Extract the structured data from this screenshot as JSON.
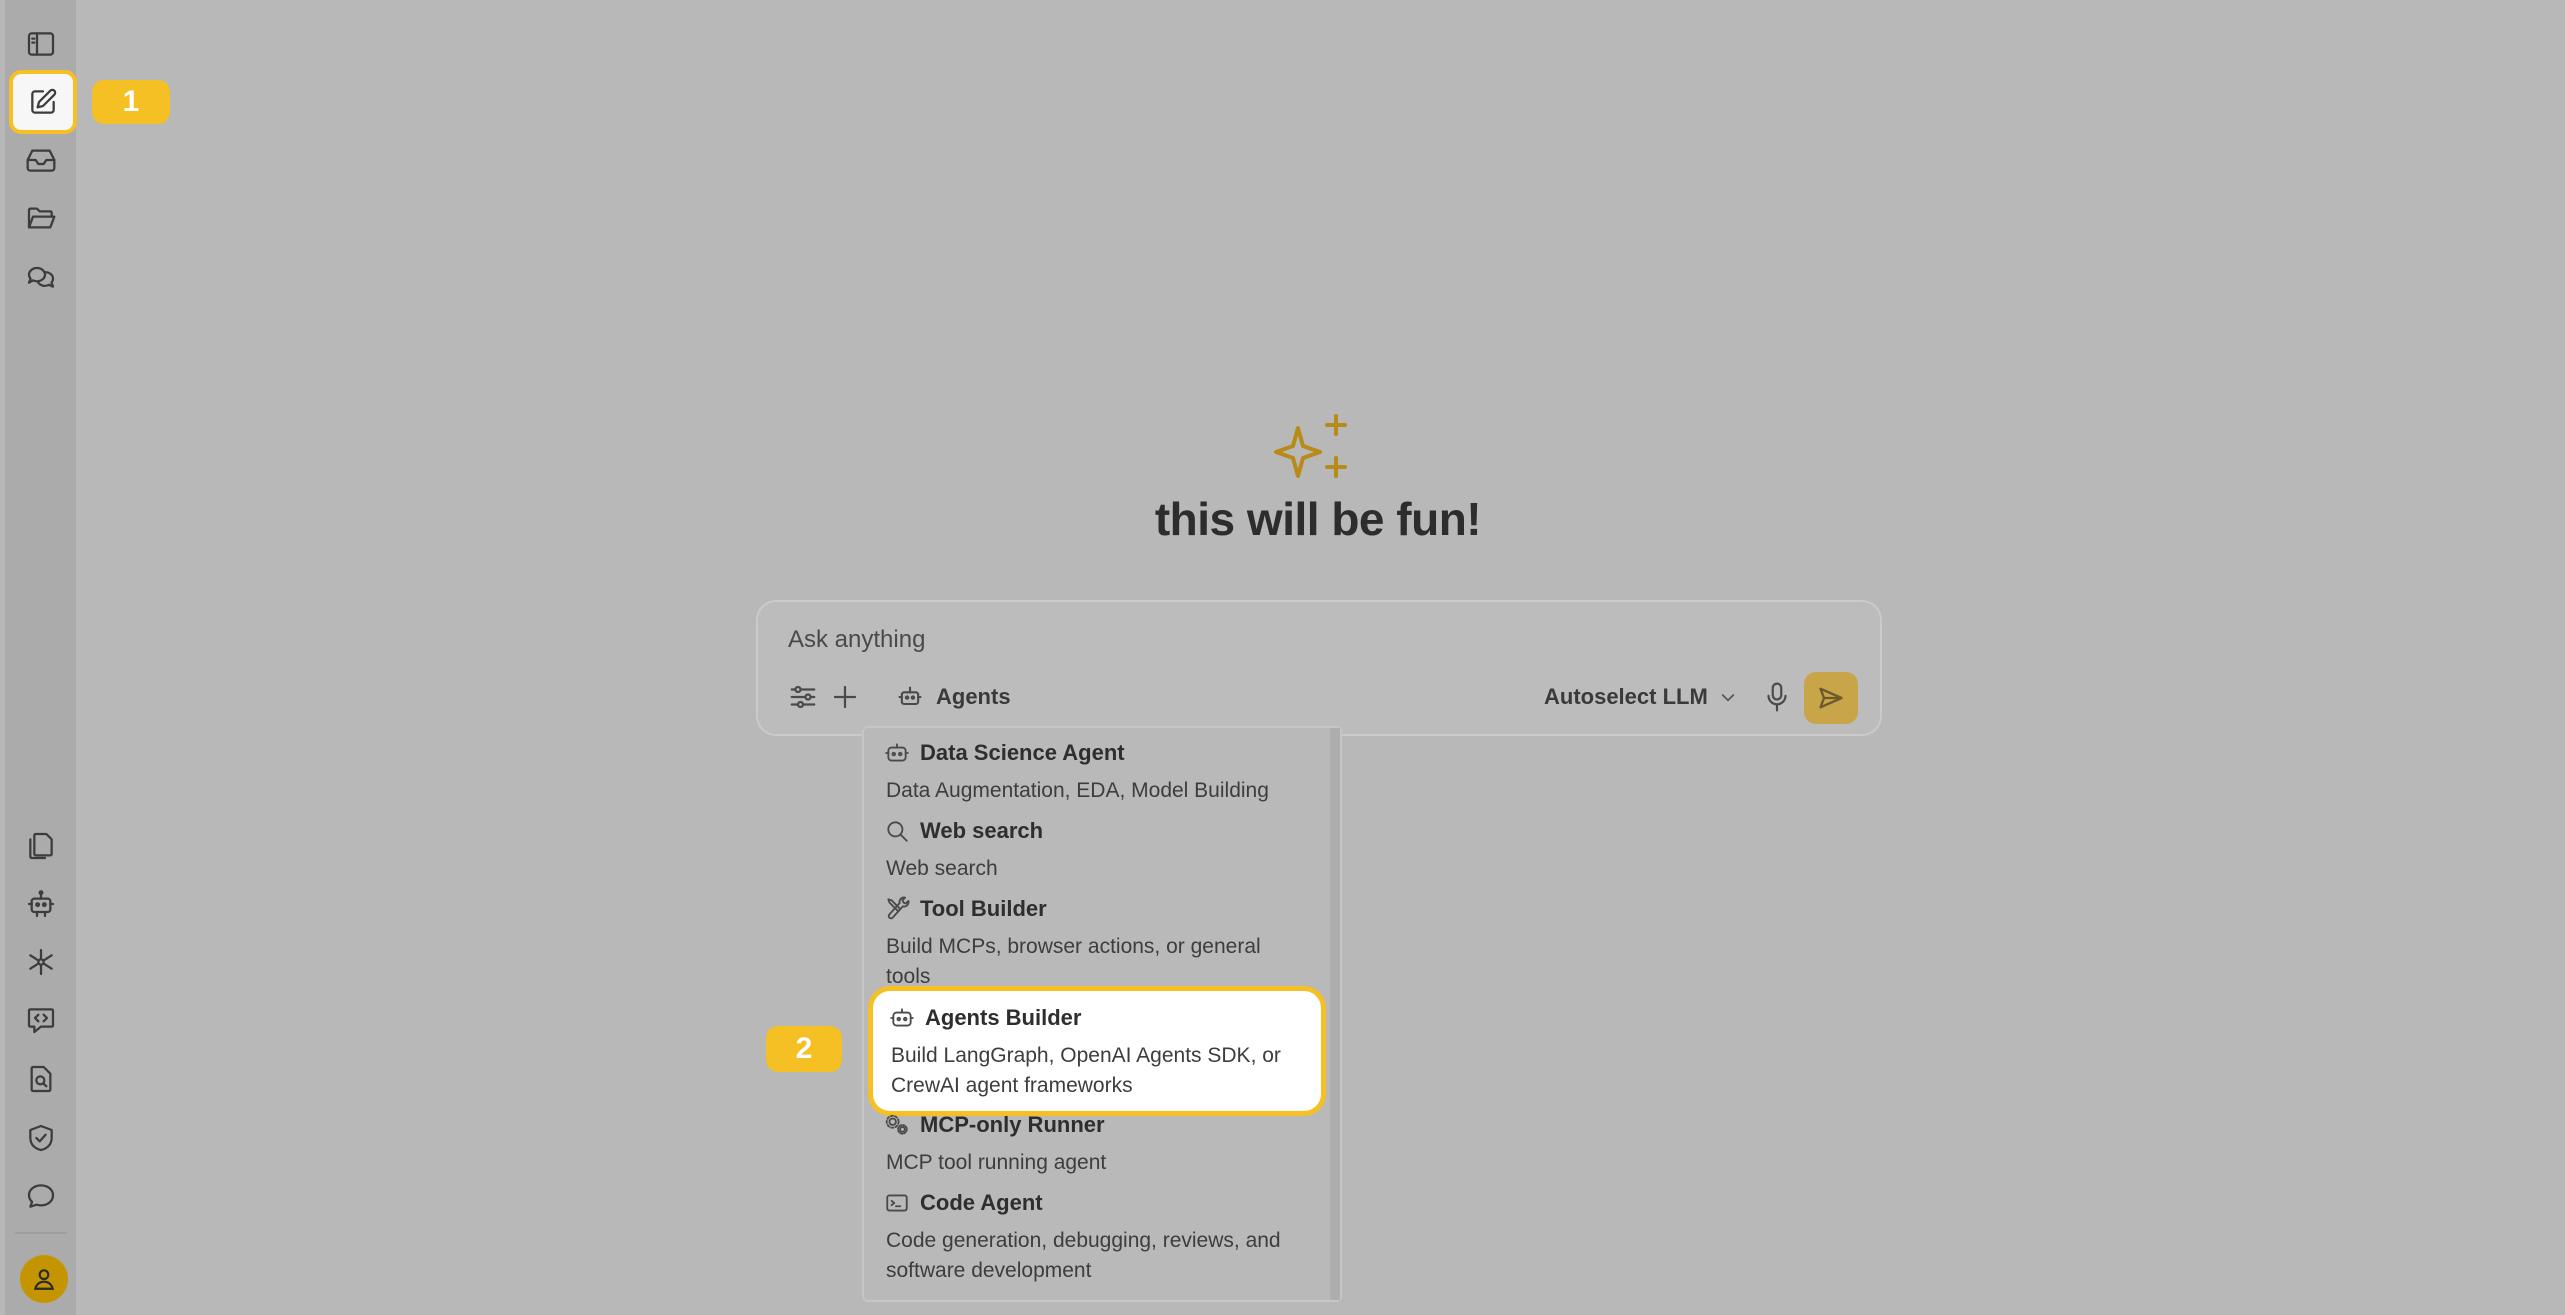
{
  "sidebar": {
    "top_items": [
      {
        "icon": "sidebar-toggle-icon"
      },
      {
        "icon": "new-chat-edit-icon"
      },
      {
        "icon": "inbox-icon"
      },
      {
        "icon": "folder-open-icon"
      },
      {
        "icon": "chats-icon"
      }
    ],
    "bottom_items": [
      {
        "icon": "files-icon"
      },
      {
        "icon": "robot-icon"
      },
      {
        "icon": "network-icon"
      },
      {
        "icon": "code-chat-icon"
      },
      {
        "icon": "file-search-icon"
      },
      {
        "icon": "shield-check-icon"
      },
      {
        "icon": "message-icon"
      }
    ],
    "avatar_icon": "user-icon"
  },
  "annotations": {
    "step1": "1",
    "step2": "2",
    "highlight_color": "#f5c023"
  },
  "hero": {
    "icon": "sparkle-icon",
    "title": "this will be fun!"
  },
  "composer": {
    "placeholder": "Ask anything",
    "agents_label": "Agents",
    "model_label": "Autoselect LLM"
  },
  "agents_menu": {
    "items": [
      {
        "icon": "robot-icon",
        "title": "Data Science Agent",
        "description": "Data Augmentation, EDA, Model Building"
      },
      {
        "icon": "search-icon",
        "title": "Web search",
        "description": "Web search"
      },
      {
        "icon": "tools-icon",
        "title": "Tool Builder",
        "description": "Build MCPs, browser actions, or general tools"
      },
      {
        "icon": "robot-icon",
        "title": "Agents Builder",
        "description": "Build LangGraph, OpenAI Agents SDK, or CrewAI agent frameworks",
        "selected": true
      },
      {
        "icon": "gears-icon",
        "title": "MCP-only Runner",
        "description": "MCP tool running agent"
      },
      {
        "icon": "terminal-icon",
        "title": "Code Agent",
        "description": "Code generation, debugging, reviews, and software development"
      }
    ]
  },
  "colors": {
    "accent": "#f5c023",
    "send_button": "#c9a54a",
    "avatar": "#c49500",
    "sparkle": "#b88a17"
  }
}
